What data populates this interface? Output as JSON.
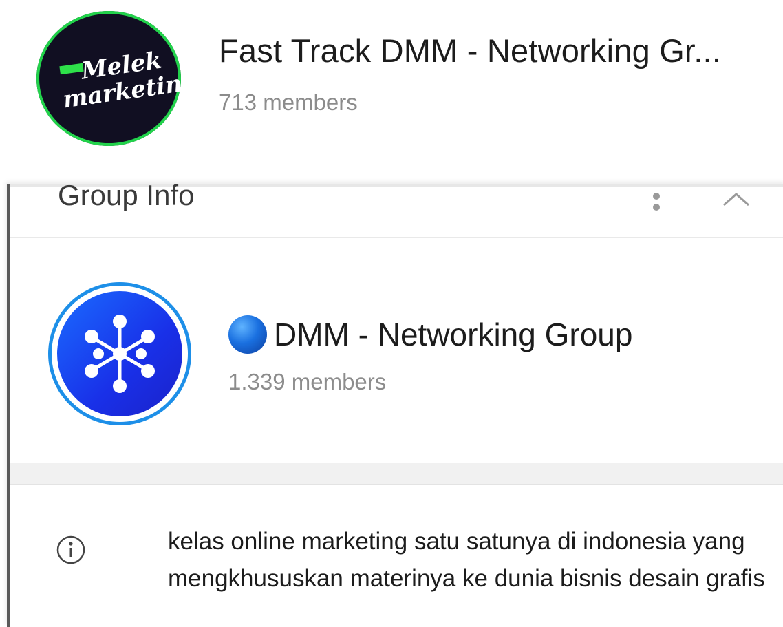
{
  "chat_header": {
    "title": "Fast Track DMM - Networking Gr...",
    "members": "713 members"
  },
  "group_info": {
    "panel_title": "Group Info",
    "group_name": "DMM - Networking Group",
    "members": "1.339 members",
    "description": "kelas online marketing satu satunya di indonesia yang mengkhususkan materinya ke dunia bisnis desain grafis"
  },
  "colors": {
    "online_ring": "#22d34b",
    "chat_avatar_bg": "#110f22",
    "group_avatar_ring": "#1d8fe8",
    "group_avatar_bg": "#1930e8",
    "secondary_text": "#8c8c8c"
  },
  "icons": {
    "more": "more-vertical-icon",
    "collapse": "chevron-up-icon",
    "info": "info-icon",
    "name_prefix": "blue-circle-emoji"
  }
}
